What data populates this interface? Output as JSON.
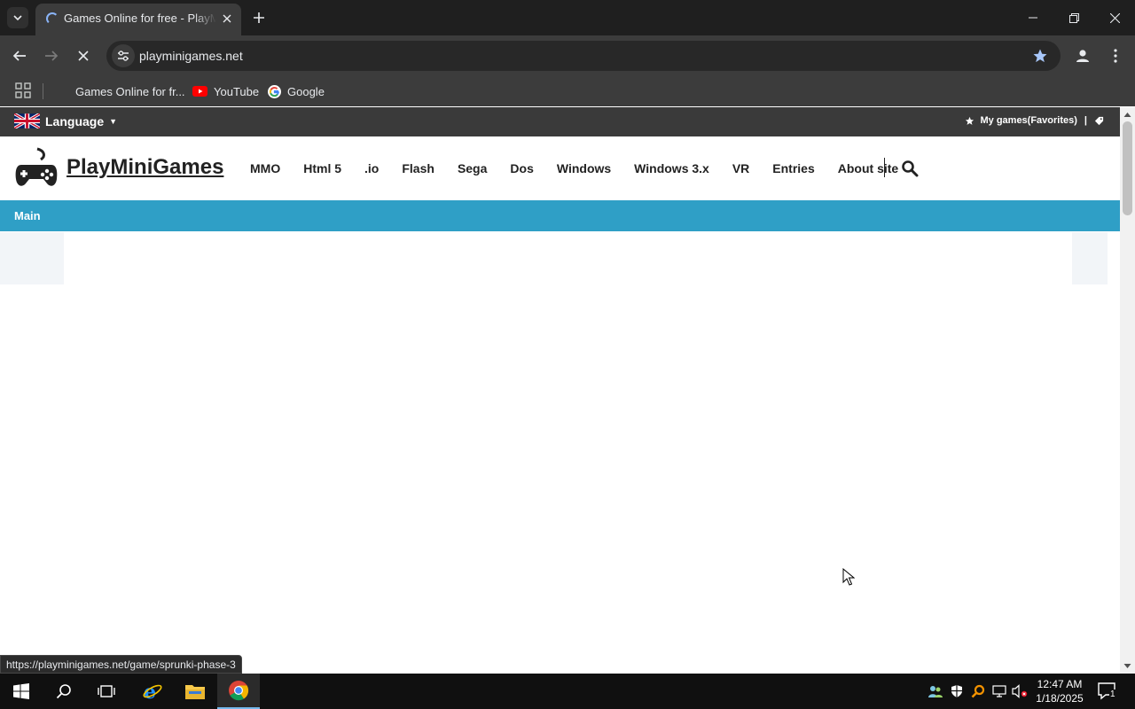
{
  "browser": {
    "tab": {
      "title": "Games Online for free - PlayMiniGames"
    },
    "url": "playminigames.net",
    "bookmarks": [
      {
        "label": "Games Online for fr..."
      },
      {
        "label": "YouTube"
      },
      {
        "label": "Google"
      }
    ],
    "status_url": "https://playminigames.net/game/sprunki-phase-3"
  },
  "site": {
    "topbar": {
      "language_label": "Language",
      "favorites_label": "My games(Favorites)",
      "favorites_sep": "|"
    },
    "logo_text": "PlayMiniGames",
    "nav": [
      "MMO",
      "Html 5",
      ".io",
      "Flash",
      "Sega",
      "Dos",
      "Windows",
      "Windows 3.x",
      "VR",
      "Entries",
      "About site"
    ],
    "breadcrumb": "Main",
    "colors": {
      "accent": "#2f9fc6",
      "topbar": "#3a3a3a"
    }
  },
  "taskbar": {
    "time": "12:47 AM",
    "date": "1/18/2025",
    "notification_count": "1"
  }
}
